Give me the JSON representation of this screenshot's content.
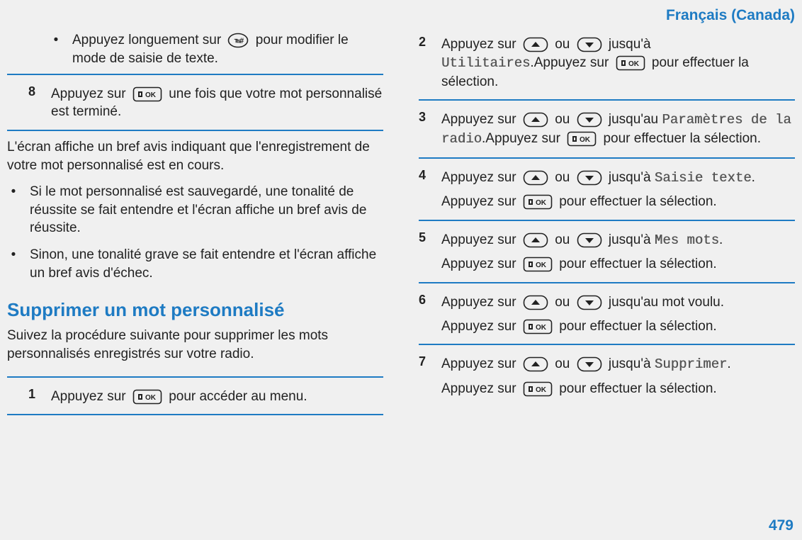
{
  "header": {
    "title": "Français (Canada)"
  },
  "pageNumber": "479",
  "left": {
    "bullet1_a": "Appuyez longuement sur",
    "bullet1_b": "pour modifier le mode de saisie de texte.",
    "step8_num": "8",
    "step8_a": "Appuyez sur",
    "step8_b": "une fois que votre mot personnalisé est terminé.",
    "para1": "L'écran affiche un bref avis indiquant que l'enregistrement de votre mot personnalisé est en cours.",
    "b2": "Si le mot personnalisé est sauvegardé, une tonalité de réussite se fait entendre et l'écran affiche un bref avis de réussite.",
    "b3": "Sinon, une tonalité grave se fait entendre et l'écran affiche un bref avis d'échec.",
    "heading": "Supprimer un mot personnalisé",
    "intro": "Suivez la procédure suivante pour supprimer les mots personnalisés enregistrés sur votre radio.",
    "step1_num": "1",
    "step1_a": "Appuyez sur",
    "step1_b": "pour accéder au menu."
  },
  "right": {
    "s2_num": "2",
    "s2_a": "Appuyez sur",
    "s2_ou": "ou",
    "s2_b": "jusqu'à",
    "s2_menu": "Utilitaires",
    "s2_dot_a": ".Appuyez sur",
    "s2_c": "pour effectuer la sélection.",
    "s3_num": "3",
    "s3_a": "Appuyez sur",
    "s3_ou": "ou",
    "s3_b": "jusqu'au",
    "s3_menu": "Paramètres de la radio",
    "s3_dot_a": ".Appuyez sur",
    "s3_c": "pour effectuer la sélection.",
    "s4_num": "4",
    "s4_a": "Appuyez sur",
    "s4_ou": "ou",
    "s4_b": "jusqu'à",
    "s4_menu": "Saisie texte",
    "s4_c": "Appuyez sur",
    "s4_d": "pour effectuer la sélection.",
    "s5_num": "5",
    "s5_a": "Appuyez sur",
    "s5_ou": "ou",
    "s5_b": "jusqu'à",
    "s5_menu": "Mes mots",
    "s5_c": "Appuyez sur",
    "s5_d": "pour effectuer la sélection.",
    "s6_num": "6",
    "s6_a": "Appuyez sur",
    "s6_ou": "ou",
    "s6_b": "jusqu'au mot voulu.",
    "s6_c": "Appuyez sur",
    "s6_d": "pour effectuer la sélection.",
    "s7_num": "7",
    "s7_a": "Appuyez sur",
    "s7_ou": "ou",
    "s7_b": "jusqu'à",
    "s7_menu": "Supprimer",
    "s7_c": "Appuyez sur",
    "s7_d": "pour effectuer la sélection."
  }
}
